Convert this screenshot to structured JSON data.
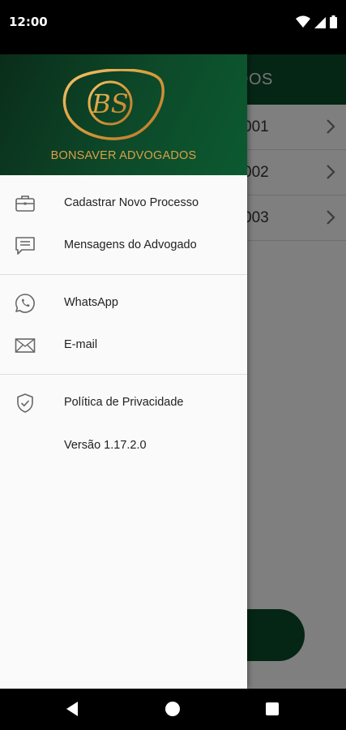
{
  "status_bar": {
    "time": "12:00",
    "icons": [
      "wifi-icon",
      "signal-icon",
      "battery-icon"
    ]
  },
  "background_app": {
    "title_fragment": "DOS",
    "rows": [
      {
        "label": "001"
      },
      {
        "label": "002"
      },
      {
        "label": "003"
      }
    ],
    "accent_color": "#0b4a2a"
  },
  "drawer": {
    "brand_name": "BONSAVER ADVOGADOS",
    "logo_letters": "BS",
    "brand_color": "#d9a04a",
    "menu_groups": [
      [
        {
          "icon": "briefcase-icon",
          "label": "Cadastrar Novo Processo"
        },
        {
          "icon": "chat-icon",
          "label": "Mensagens do Advogado"
        }
      ],
      [
        {
          "icon": "whatsapp-icon",
          "label": "WhatsApp"
        },
        {
          "icon": "mail-icon",
          "label": "E-mail"
        }
      ],
      [
        {
          "icon": "shield-check-icon",
          "label": "Política de Privacidade"
        }
      ]
    ],
    "version": "Versão 1.17.2.0"
  },
  "nav_bar": {
    "buttons": [
      "back-icon",
      "home-icon",
      "recents-icon"
    ]
  }
}
